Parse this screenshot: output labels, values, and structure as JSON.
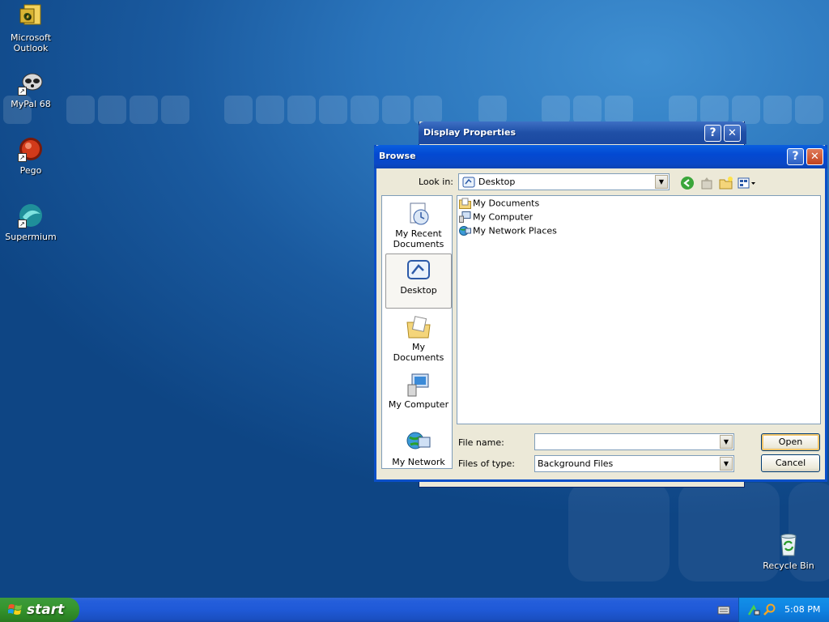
{
  "desktop": {
    "icons": [
      {
        "label": "Microsoft Outlook"
      },
      {
        "label": "MyPal 68"
      },
      {
        "label": "Pego"
      },
      {
        "label": "Supermium"
      },
      {
        "label": "Recycle Bin"
      }
    ]
  },
  "display_window": {
    "title": "Display Properties",
    "help": "?",
    "close": "✕"
  },
  "browse": {
    "title": "Browse",
    "help": "?",
    "close": "✕",
    "look_in_label": "Look in:",
    "look_in_value": "Desktop",
    "places": [
      {
        "label": "My Recent Documents"
      },
      {
        "label": "Desktop"
      },
      {
        "label": "My Documents"
      },
      {
        "label": "My Computer"
      },
      {
        "label": "My Network"
      }
    ],
    "files": [
      {
        "label": "My Documents"
      },
      {
        "label": "My Computer"
      },
      {
        "label": "My Network Places"
      }
    ],
    "file_name_label": "File name:",
    "file_name_value": "",
    "files_of_type_label": "Files of type:",
    "files_of_type_value": "Background Files",
    "open_button": "Open",
    "cancel_button": "Cancel"
  },
  "taskbar": {
    "start_label": "start",
    "clock": "5:08 PM"
  },
  "colors": {
    "title_blue": "#0349d2",
    "close_red": "#c1421e",
    "start_green": "#36962f",
    "desktop_blue": "#1a5a9f"
  }
}
